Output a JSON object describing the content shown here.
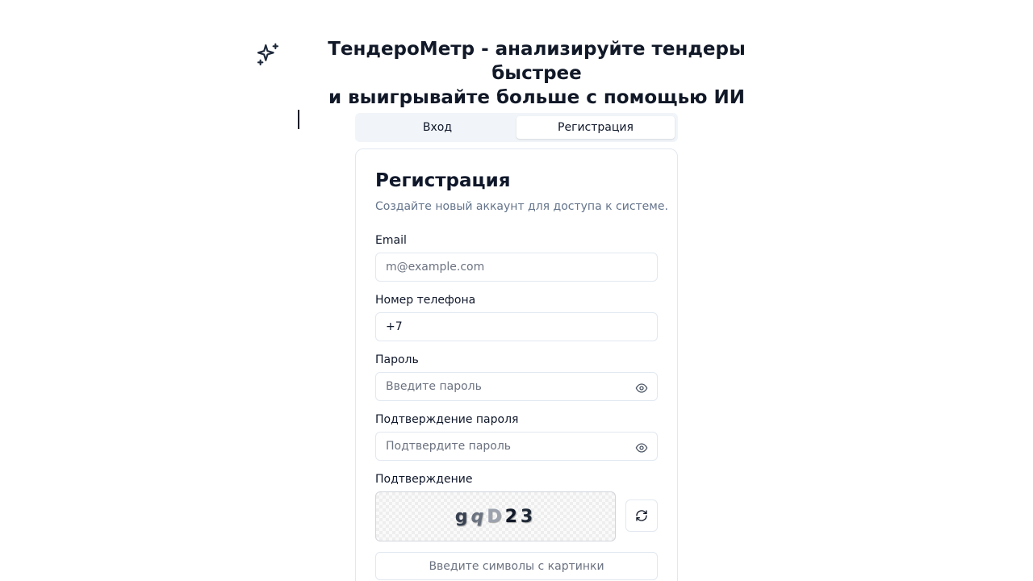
{
  "header": {
    "title_line1": "ТендероМетр - анализируйте тендеры быстрее",
    "title_line2": "и выигрывайте больше с помощью ИИ",
    "icon": "sparkles-icon"
  },
  "tabs": [
    {
      "label": "Вход",
      "active": false
    },
    {
      "label": "Регистрация",
      "active": true
    }
  ],
  "card": {
    "title": "Регистрация",
    "description": "Создайте новый аккаунт для доступа к системе."
  },
  "form": {
    "email": {
      "label": "Email",
      "placeholder": "m@example.com",
      "value": ""
    },
    "phone": {
      "label": "Номер телефона",
      "value": "+7"
    },
    "password": {
      "label": "Пароль",
      "placeholder": "Введите пароль",
      "icon": "eye-icon"
    },
    "confirm_password": {
      "label": "Подтверждение пароля",
      "placeholder": "Подтвердите пароль",
      "icon": "eye-icon"
    },
    "captcha": {
      "label": "Подтверждение",
      "chars": [
        "g",
        "q",
        "D",
        "2",
        "3"
      ],
      "input_placeholder": "Введите символы с картинки",
      "refresh_icon": "refresh-icon"
    }
  }
}
